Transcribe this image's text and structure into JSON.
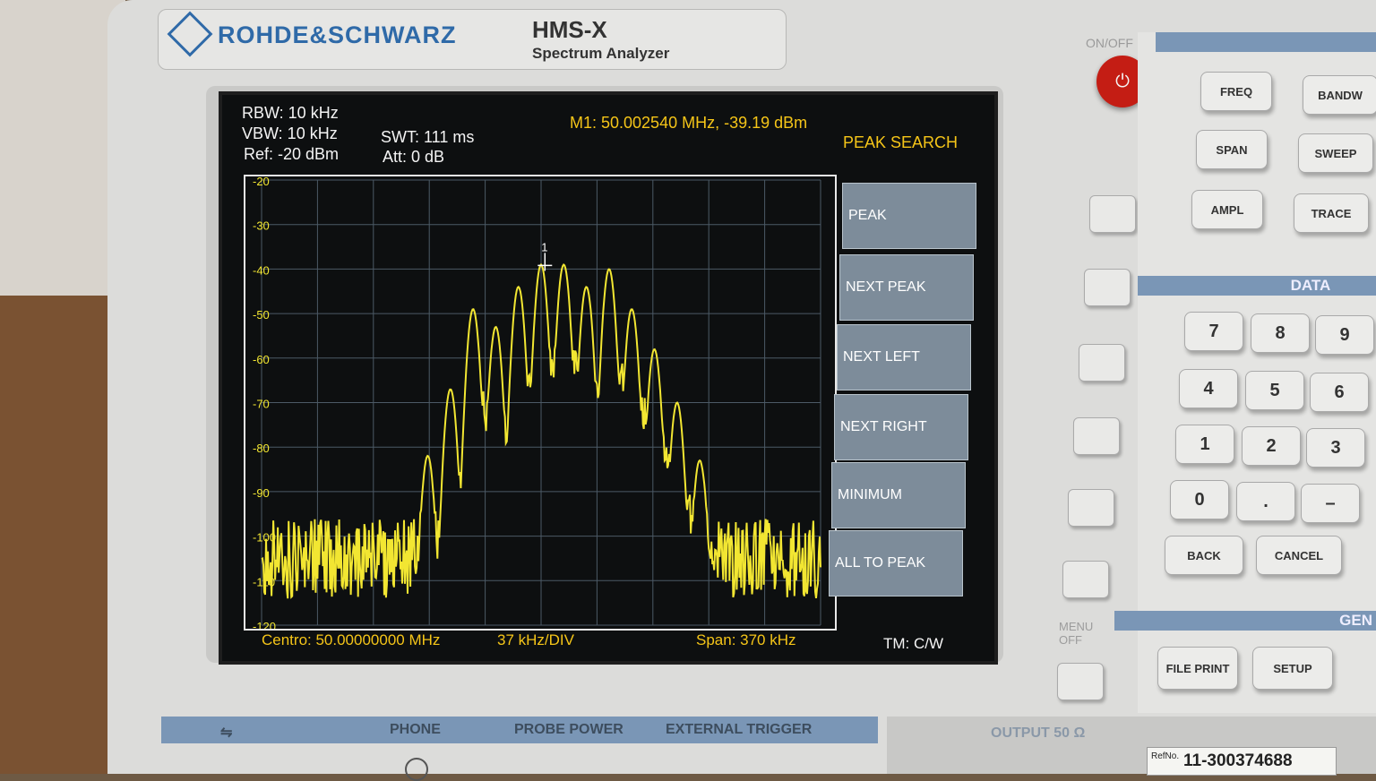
{
  "device": {
    "brand": "ROHDE&SCHWARZ",
    "model": "HMS-X",
    "subtitle": "Spectrum Analyzer",
    "power_label": "ON/OFF",
    "menu_off_label": "MENU OFF"
  },
  "screen": {
    "rbw": "RBW: 10 kHz",
    "vbw": "VBW: 10 kHz",
    "ref": "Ref: -20 dBm",
    "swt": "SWT: 111 ms",
    "att": "Att: 0 dB",
    "marker": "M1: 50.002540 MHz, -39.19 dBm",
    "menu_title": "PEAK SEARCH",
    "center": "Centro: 50.00000000 MHz",
    "div": "37 kHz/DIV",
    "span": "Span: 370 kHz",
    "tm": "TM: C/W",
    "marker_tag": "1"
  },
  "softkeys": [
    "PEAK",
    "NEXT PEAK",
    "NEXT LEFT",
    "NEXT RIGHT",
    "MINIMUM",
    "ALL TO PEAK"
  ],
  "panel": {
    "function_keys": [
      "FREQ",
      "BANDW",
      "SPAN",
      "SWEEP",
      "AMPL",
      "TRACE"
    ],
    "data_label": "DATA",
    "numpad": [
      "7",
      "8",
      "9",
      "4",
      "5",
      "6",
      "1",
      "2",
      "3",
      "0",
      ".",
      "–"
    ],
    "back": "BACK",
    "cancel": "CANCEL",
    "gen_label": "GEN",
    "file_print": "FILE PRINT",
    "setup": "SETUP"
  },
  "front": {
    "phone": "PHONE",
    "probe_power": "PROBE POWER",
    "external_trigger": "EXTERNAL TRIGGER",
    "output": "OUTPUT 50 Ω",
    "ref_no_label": "RefNo.",
    "ref_no": "11-300374688"
  },
  "chart_data": {
    "type": "line",
    "y_ticks": [
      "-20",
      "-30",
      "-40",
      "-50",
      "-60",
      "-70",
      "-80",
      "-90",
      "-100",
      "-110",
      "-120"
    ],
    "ylim": [
      -120,
      -20
    ],
    "xlim": [
      49.815,
      50.185
    ],
    "x_unit": "MHz",
    "y_unit": "dBm",
    "grid": true,
    "trace_color": "#f2e632",
    "peaks_x": [
      49.925,
      49.94,
      49.955,
      49.97,
      49.985,
      50.0,
      50.015,
      50.03,
      50.045,
      50.06,
      50.075,
      50.09,
      50.105
    ],
    "peaks_y": [
      -82,
      -67,
      -49,
      -53,
      -44,
      -39,
      -39,
      -44,
      -40,
      -49,
      -58,
      -70,
      -83
    ],
    "noise_floor": -105,
    "marker": {
      "x": 50.00254,
      "y": -39.19
    }
  }
}
